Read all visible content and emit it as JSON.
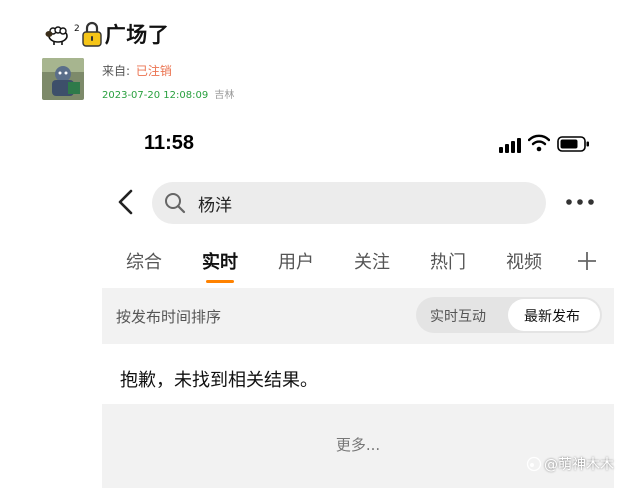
{
  "post": {
    "title_superscript": "2",
    "title_text": "广场了",
    "source_prefix": "来自:",
    "source_user": "已注销",
    "timestamp": "2023-07-20 12:08:09",
    "location": "吉林"
  },
  "phone": {
    "time": "11:58",
    "search": {
      "query": "杨洋"
    },
    "tabs": [
      {
        "label": "综合",
        "active": false
      },
      {
        "label": "实时",
        "active": true
      },
      {
        "label": "用户",
        "active": false
      },
      {
        "label": "关注",
        "active": false
      },
      {
        "label": "热门",
        "active": false
      },
      {
        "label": "视频",
        "active": false
      }
    ],
    "sort": {
      "label": "按发布时间排序",
      "options": [
        "实时互动",
        "最新发布"
      ],
      "selected": "最新发布"
    },
    "empty_message": "抱歉，未找到相关结果。",
    "more_label": "更多..."
  },
  "watermark": {
    "text": "@萌神木木"
  },
  "colors": {
    "accent": "#ff8200",
    "source_user": "#eb7350",
    "timestamp": "#29a03f"
  },
  "icons": [
    "sheep-icon",
    "lock-icon",
    "avatar",
    "signal-icon",
    "wifi-icon",
    "battery-icon",
    "back-icon",
    "search-icon",
    "more-icon",
    "plus-icon"
  ]
}
